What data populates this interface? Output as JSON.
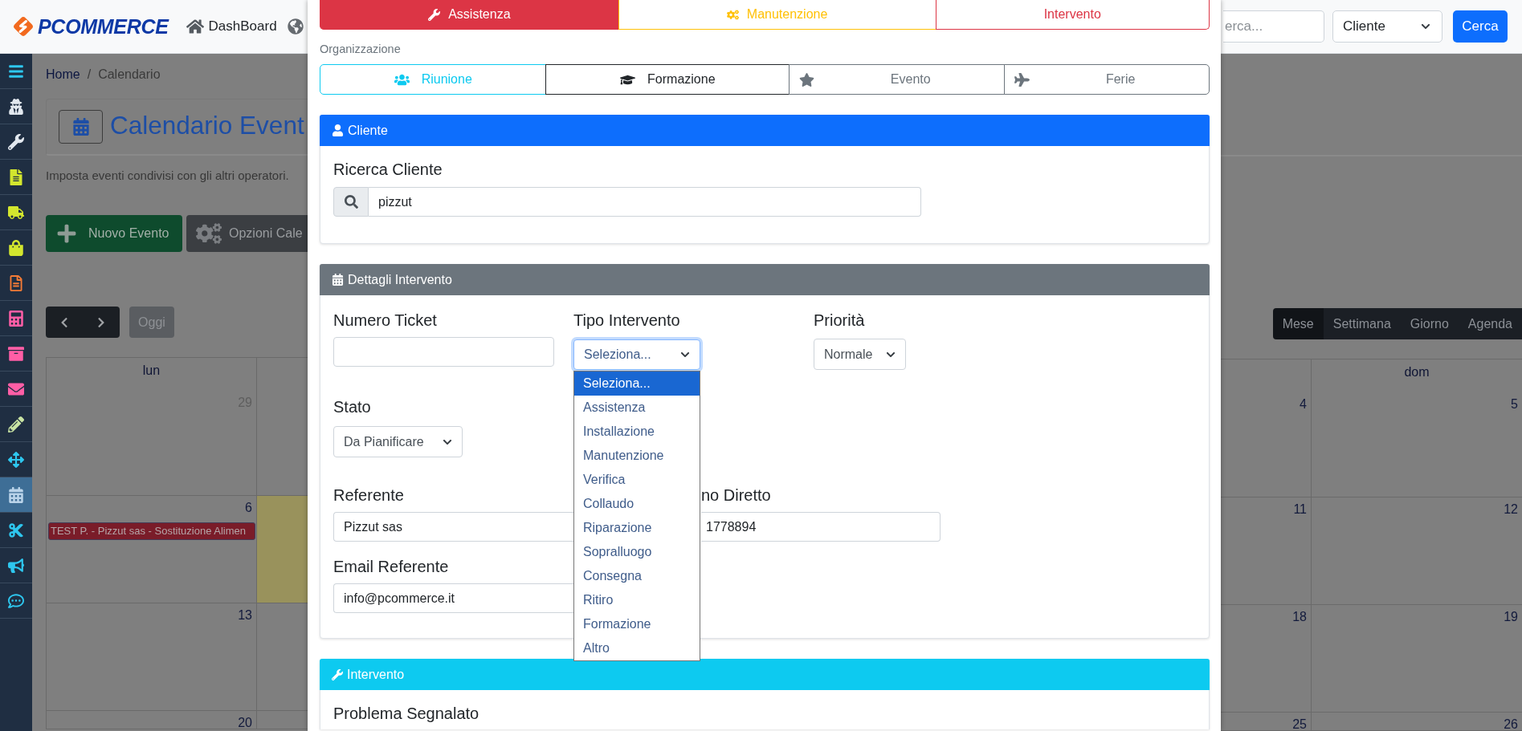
{
  "header": {
    "logo": "PCOMMERCE",
    "nav": [
      {
        "label": "DashBoard"
      }
    ],
    "search": {
      "placeholder": "erca..."
    },
    "scope_select": {
      "value": "Cliente"
    },
    "search_button": "Cerca"
  },
  "sidebar": {
    "items": [
      {
        "color": "#2ec7ef",
        "selected": false
      },
      {
        "color": "#e2e8ef",
        "selected": false
      },
      {
        "color": "#e2e8ef",
        "selected": false
      },
      {
        "color": "#d3e62e",
        "selected": false
      },
      {
        "color": "#d3e62e",
        "selected": false
      },
      {
        "color": "#d3e62e",
        "selected": false
      },
      {
        "color": "#f47b36",
        "selected": false
      },
      {
        "color": "#ff5ea6",
        "selected": false
      },
      {
        "color": "#ff5ea6",
        "selected": false
      },
      {
        "color": "#ff5ea6",
        "selected": false
      },
      {
        "color": "#c9e4a4",
        "selected": false
      },
      {
        "color": "#2ec7ef",
        "selected": false
      },
      {
        "color": "#b9d3e9",
        "selected": true
      },
      {
        "color": "#2ec7ef",
        "selected": false
      },
      {
        "color": "#2ec7ef",
        "selected": false
      },
      {
        "color": "#2ec7ef",
        "selected": false
      }
    ]
  },
  "page": {
    "breadcrumb": {
      "items": [
        "Home",
        "Calendario"
      ],
      "separator": "/"
    },
    "title": "Calendario Event",
    "description": "Imposta eventi condivisi con gli altri operatori.",
    "actions": [
      {
        "label": "Nuovo Evento",
        "kind": "create"
      },
      {
        "label": "Opzioni Cale",
        "kind": "options"
      }
    ],
    "today_button": "Oggi",
    "views": [
      {
        "label": "Mese",
        "selected": true
      },
      {
        "label": "Settimana",
        "selected": false
      },
      {
        "label": "Giorno",
        "selected": false
      },
      {
        "label": "Agenda",
        "selected": false
      }
    ]
  },
  "calendar": {
    "columns": [
      {
        "header": "lun",
        "days": [
          {
            "number": "29",
            "outside_month": true,
            "today": false
          },
          {
            "number": "6",
            "outside_month": false,
            "today": false,
            "events": [
              {
                "title": "TEST P. - Pizzut sas - Sostituzione Alimen"
              }
            ]
          },
          {
            "number": "13",
            "outside_month": false,
            "today": false
          },
          {
            "number": "20",
            "outside_month": false,
            "today": false
          }
        ]
      },
      {
        "days": [
          {
            "today": false
          },
          {
            "today": true
          },
          {
            "today": false
          },
          {
            "today": false
          }
        ]
      },
      {
        "days": [
          {
            "number": "4",
            "outside_month": false,
            "today": false
          },
          {
            "number": "11",
            "outside_month": false,
            "today": false
          },
          {
            "number": "18",
            "outside_month": false,
            "today": false
          },
          {
            "number": "25",
            "outside_month": false,
            "today": false
          }
        ]
      },
      {
        "header": "dom",
        "days": [
          {
            "number": "5",
            "outside_month": false,
            "today": false
          },
          {
            "number": "12",
            "outside_month": false,
            "today": false
          },
          {
            "number": "19",
            "outside_month": false,
            "today": false
          },
          {
            "number": "26",
            "outside_month": false,
            "today": false
          }
        ]
      }
    ]
  },
  "modal": {
    "categories": [
      {
        "label": "Assistenza",
        "color": "#dc3545",
        "selected": true
      },
      {
        "label": "Manutenzione",
        "color": "#ffc107",
        "selected": false
      },
      {
        "label": "Intervento",
        "color": "#dc3545",
        "selected": false
      }
    ],
    "organization": {
      "label": "Organizzazione",
      "options": [
        {
          "label": "Riunione",
          "color": "#0dcaf0",
          "selected": false
        },
        {
          "label": "Formazione",
          "color": "#212529",
          "selected": false
        },
        {
          "label": "Evento",
          "color": "#6c757d",
          "selected": false
        },
        {
          "label": "Ferie",
          "color": "#6c757d",
          "selected": false
        }
      ]
    },
    "client_panel": {
      "title": "Cliente",
      "search": {
        "label": "Ricerca Cliente",
        "value": "pizzut"
      }
    },
    "details_panel": {
      "title": "Dettagli Intervento",
      "ticket": {
        "label": "Numero Ticket"
      },
      "type": {
        "label": "Tipo Intervento",
        "value": "Seleziona...",
        "expanded": true,
        "options": [
          {
            "label": "Seleziona...",
            "selected": true
          },
          {
            "label": "Assistenza",
            "selected": false
          },
          {
            "label": "Installazione",
            "selected": false
          },
          {
            "label": "Manutenzione",
            "selected": false
          },
          {
            "label": "Verifica",
            "selected": false
          },
          {
            "label": "Collaudo",
            "selected": false
          },
          {
            "label": "Riparazione",
            "selected": false
          },
          {
            "label": "Sopralluogo",
            "selected": false
          },
          {
            "label": "Consegna",
            "selected": false
          },
          {
            "label": "Ritiro",
            "selected": false
          },
          {
            "label": "Formazione",
            "selected": false
          },
          {
            "label": "Altro",
            "selected": false
          }
        ]
      },
      "priority": {
        "label": "Priorità",
        "value": "Normale"
      },
      "status": {
        "label": "Stato",
        "value": "Da Pianificare"
      },
      "contact": {
        "label": "Referente",
        "value": "Pizzut sas"
      },
      "phone": {
        "label": "no Diretto",
        "value": "1778894"
      },
      "email": {
        "label": "Email Referente",
        "value": "info@pcommerce.it"
      }
    },
    "intervention_panel": {
      "title": "Intervento",
      "problem": {
        "label": "Problema Segnalato"
      }
    }
  }
}
